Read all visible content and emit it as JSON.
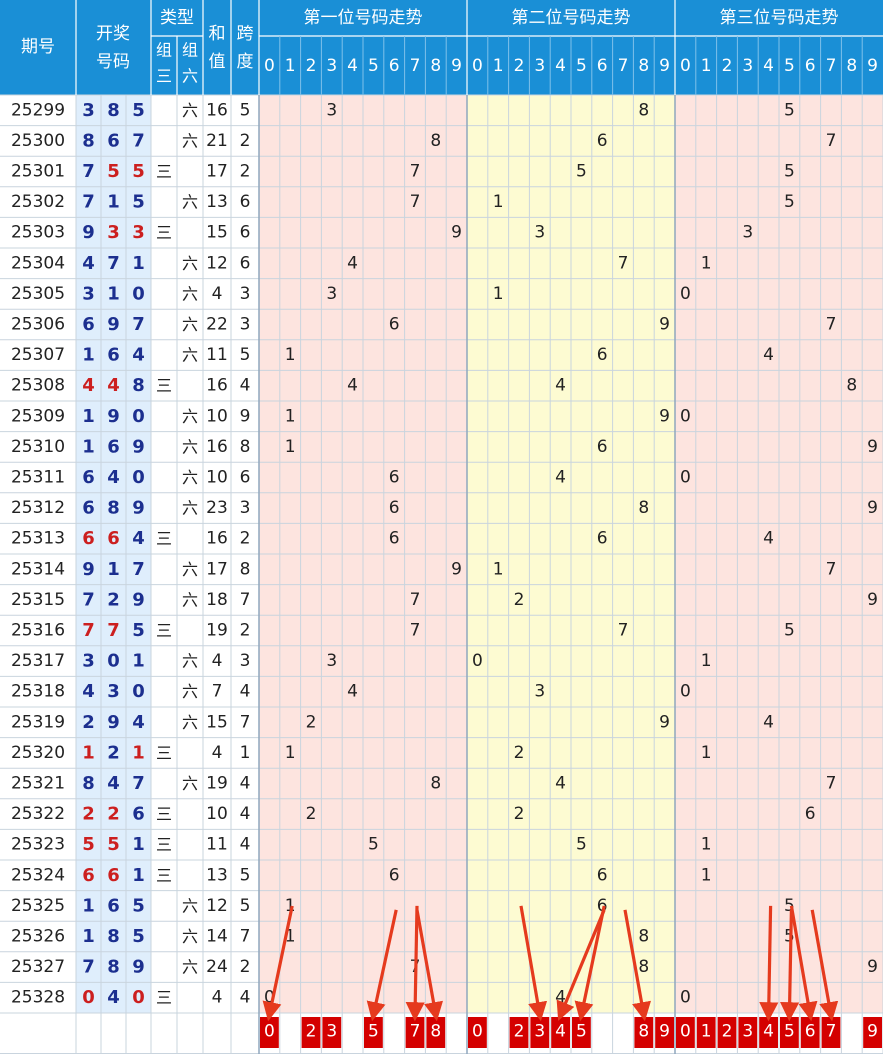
{
  "header": {
    "period": "期号",
    "draw_top": "开奖",
    "draw_bottom": "号码",
    "type_group": "类型",
    "type_three_top": "组",
    "type_three_bottom": "三",
    "type_six_top": "组",
    "type_six_bottom": "六",
    "sum_top": "和",
    "sum_bottom": "值",
    "span_top": "跨",
    "span_bottom": "度",
    "pos1": "第一位号码走势",
    "pos2": "第二位号码走势",
    "pos3": "第三位号码走势",
    "digits": [
      "0",
      "1",
      "2",
      "3",
      "4",
      "5",
      "6",
      "7",
      "8",
      "9"
    ]
  },
  "labels": {
    "three": "三",
    "six": "六"
  },
  "colors": {
    "header_bg": "#1a8fd6",
    "repeat_digit": "#cc1f1f",
    "normal_digit": "#1c2f8f",
    "zone_pink": "#fde4df",
    "zone_yellow": "#fdfbd2",
    "left_blue": "#dfeefc",
    "marker_red": "#d40000",
    "arrow_red": "#e53a1e"
  },
  "chart_data": {
    "type": "table",
    "rows": [
      {
        "period": "25299",
        "draw": [
          3,
          8,
          5
        ],
        "type": "六",
        "sum": 16,
        "span": 5
      },
      {
        "period": "25300",
        "draw": [
          8,
          6,
          7
        ],
        "type": "六",
        "sum": 21,
        "span": 2
      },
      {
        "period": "25301",
        "draw": [
          7,
          5,
          5
        ],
        "type": "三",
        "sum": 17,
        "span": 2
      },
      {
        "period": "25302",
        "draw": [
          7,
          1,
          5
        ],
        "type": "六",
        "sum": 13,
        "span": 6
      },
      {
        "period": "25303",
        "draw": [
          9,
          3,
          3
        ],
        "type": "三",
        "sum": 15,
        "span": 6
      },
      {
        "period": "25304",
        "draw": [
          4,
          7,
          1
        ],
        "type": "六",
        "sum": 12,
        "span": 6
      },
      {
        "period": "25305",
        "draw": [
          3,
          1,
          0
        ],
        "type": "六",
        "sum": 4,
        "span": 3
      },
      {
        "period": "25306",
        "draw": [
          6,
          9,
          7
        ],
        "type": "六",
        "sum": 22,
        "span": 3
      },
      {
        "period": "25307",
        "draw": [
          1,
          6,
          4
        ],
        "type": "六",
        "sum": 11,
        "span": 5
      },
      {
        "period": "25308",
        "draw": [
          4,
          4,
          8
        ],
        "type": "三",
        "sum": 16,
        "span": 4
      },
      {
        "period": "25309",
        "draw": [
          1,
          9,
          0
        ],
        "type": "六",
        "sum": 10,
        "span": 9
      },
      {
        "period": "25310",
        "draw": [
          1,
          6,
          9
        ],
        "type": "六",
        "sum": 16,
        "span": 8
      },
      {
        "period": "25311",
        "draw": [
          6,
          4,
          0
        ],
        "type": "六",
        "sum": 10,
        "span": 6
      },
      {
        "period": "25312",
        "draw": [
          6,
          8,
          9
        ],
        "type": "六",
        "sum": 23,
        "span": 3
      },
      {
        "period": "25313",
        "draw": [
          6,
          6,
          4
        ],
        "type": "三",
        "sum": 16,
        "span": 2
      },
      {
        "period": "25314",
        "draw": [
          9,
          1,
          7
        ],
        "type": "六",
        "sum": 17,
        "span": 8
      },
      {
        "period": "25315",
        "draw": [
          7,
          2,
          9
        ],
        "type": "六",
        "sum": 18,
        "span": 7
      },
      {
        "period": "25316",
        "draw": [
          7,
          7,
          5
        ],
        "type": "三",
        "sum": 19,
        "span": 2
      },
      {
        "period": "25317",
        "draw": [
          3,
          0,
          1
        ],
        "type": "六",
        "sum": 4,
        "span": 3
      },
      {
        "period": "25318",
        "draw": [
          4,
          3,
          0
        ],
        "type": "六",
        "sum": 7,
        "span": 4
      },
      {
        "period": "25319",
        "draw": [
          2,
          9,
          4
        ],
        "type": "六",
        "sum": 15,
        "span": 7
      },
      {
        "period": "25320",
        "draw": [
          1,
          2,
          1
        ],
        "type": "三",
        "sum": 4,
        "span": 1
      },
      {
        "period": "25321",
        "draw": [
          8,
          4,
          7
        ],
        "type": "六",
        "sum": 19,
        "span": 4
      },
      {
        "period": "25322",
        "draw": [
          2,
          2,
          6
        ],
        "type": "三",
        "sum": 10,
        "span": 4
      },
      {
        "period": "25323",
        "draw": [
          5,
          5,
          1
        ],
        "type": "三",
        "sum": 11,
        "span": 4
      },
      {
        "period": "25324",
        "draw": [
          6,
          6,
          1
        ],
        "type": "三",
        "sum": 13,
        "span": 5
      },
      {
        "period": "25325",
        "draw": [
          1,
          6,
          5
        ],
        "type": "六",
        "sum": 12,
        "span": 5
      },
      {
        "period": "25326",
        "draw": [
          1,
          8,
          5
        ],
        "type": "六",
        "sum": 14,
        "span": 7
      },
      {
        "period": "25327",
        "draw": [
          7,
          8,
          9
        ],
        "type": "六",
        "sum": 24,
        "span": 2
      },
      {
        "period": "25328",
        "draw": [
          0,
          4,
          0
        ],
        "type": "三",
        "sum": 4,
        "span": 4
      }
    ],
    "selection": {
      "pos1": [
        "0",
        "2",
        "3",
        "5",
        "7",
        "8"
      ],
      "pos2": [
        "0",
        "2",
        "3",
        "4",
        "5",
        "8",
        "9"
      ],
      "pos3": [
        "0",
        "1",
        "2",
        "3",
        "4",
        "5",
        "6",
        "7",
        "9"
      ]
    },
    "arrows": [
      {
        "from": [
          1,
          "1"
        ],
        "to": [
          1,
          "0"
        ]
      },
      {
        "from": [
          1,
          "6"
        ],
        "to": [
          1,
          "5"
        ]
      },
      {
        "from": [
          1,
          "7"
        ],
        "to": [
          1,
          "7"
        ]
      },
      {
        "from": [
          1,
          "7"
        ],
        "to": [
          1,
          "8"
        ]
      },
      {
        "from": [
          2,
          "2"
        ],
        "to": [
          2,
          "3"
        ]
      },
      {
        "from": [
          2,
          "6"
        ],
        "to": [
          2,
          "4"
        ]
      },
      {
        "from": [
          2,
          "6"
        ],
        "to": [
          2,
          "5"
        ]
      },
      {
        "from": [
          2,
          "7"
        ],
        "to": [
          2,
          "8"
        ]
      },
      {
        "from": [
          3,
          "4"
        ],
        "to": [
          3,
          "4"
        ]
      },
      {
        "from": [
          3,
          "5"
        ],
        "to": [
          3,
          "5"
        ]
      },
      {
        "from": [
          3,
          "5"
        ],
        "to": [
          3,
          "6"
        ]
      },
      {
        "from": [
          3,
          "6"
        ],
        "to": [
          3,
          "7"
        ]
      }
    ]
  }
}
